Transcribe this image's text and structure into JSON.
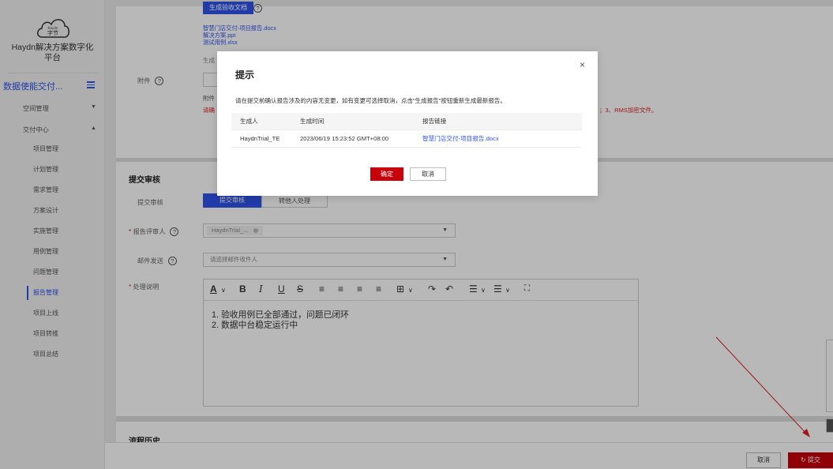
{
  "sidebar": {
    "brand_logo": "Haydn 字节",
    "brand_name_line1": "Haydn解决方案数字化",
    "brand_name_line2": "平台",
    "system_title": "数据使能交付...",
    "groups": [
      {
        "label": "空间管理",
        "arrow": "▼"
      },
      {
        "label": "交付中心",
        "arrow": "▲"
      }
    ],
    "items": [
      {
        "label": "项目管理"
      },
      {
        "label": "计划管理"
      },
      {
        "label": "需求管理"
      },
      {
        "label": "方案设计"
      },
      {
        "label": "实施管理"
      },
      {
        "label": "用例管理"
      },
      {
        "label": "问题管理"
      },
      {
        "label": "报告管理",
        "active": true
      },
      {
        "label": "项目上线"
      },
      {
        "label": "项目转维"
      },
      {
        "label": "项目总结"
      }
    ]
  },
  "attachments": {
    "generate_button": "生成验收文档",
    "files": [
      "智慧门店交付-项目报告.docx",
      "解决方案.ppt",
      "测试用例.xlsx"
    ],
    "hint_partial": "生成",
    "label": "附件",
    "note_partial": "附件",
    "warning_partial": "请确",
    "warning_tail": "；3、RMS加密文件。"
  },
  "review": {
    "section_title": "提交审核",
    "submit_label": "提交审核",
    "tab_submit": "提交审核",
    "tab_transfer": "转他人处理",
    "reviewer_label": "报告评审人",
    "reviewer_value": "HaydnTrial_...",
    "email_label": "邮件发送",
    "email_placeholder": "请选择邮件收件人",
    "desc_label": "处理说明",
    "editor_lines": [
      "1. 验收用例已全部通过，问题已闭环",
      "2. 数据中台稳定运行中"
    ]
  },
  "history": {
    "section_title": "流程历史"
  },
  "footer": {
    "cancel": "取消",
    "submit": "提交"
  },
  "dialog": {
    "title": "提示",
    "close": "×",
    "message": "请在提交前确认报告涉及的内容无变更，如有变更可选择取消，点击\"生成报告\"按钮重新生成最新报告。",
    "headers": [
      "生成人",
      "生成时间",
      "报告链接"
    ],
    "rows": [
      {
        "creator": "HaydnTrial_TE",
        "time": "2023/06/19 15:23:52 GMT+08:00",
        "link": "智慧门店交付-项目报告.docx"
      }
    ],
    "ok": "确定",
    "cancel": "取消"
  },
  "colors": {
    "accent": "#2f54eb",
    "danger": "#c7000b"
  }
}
